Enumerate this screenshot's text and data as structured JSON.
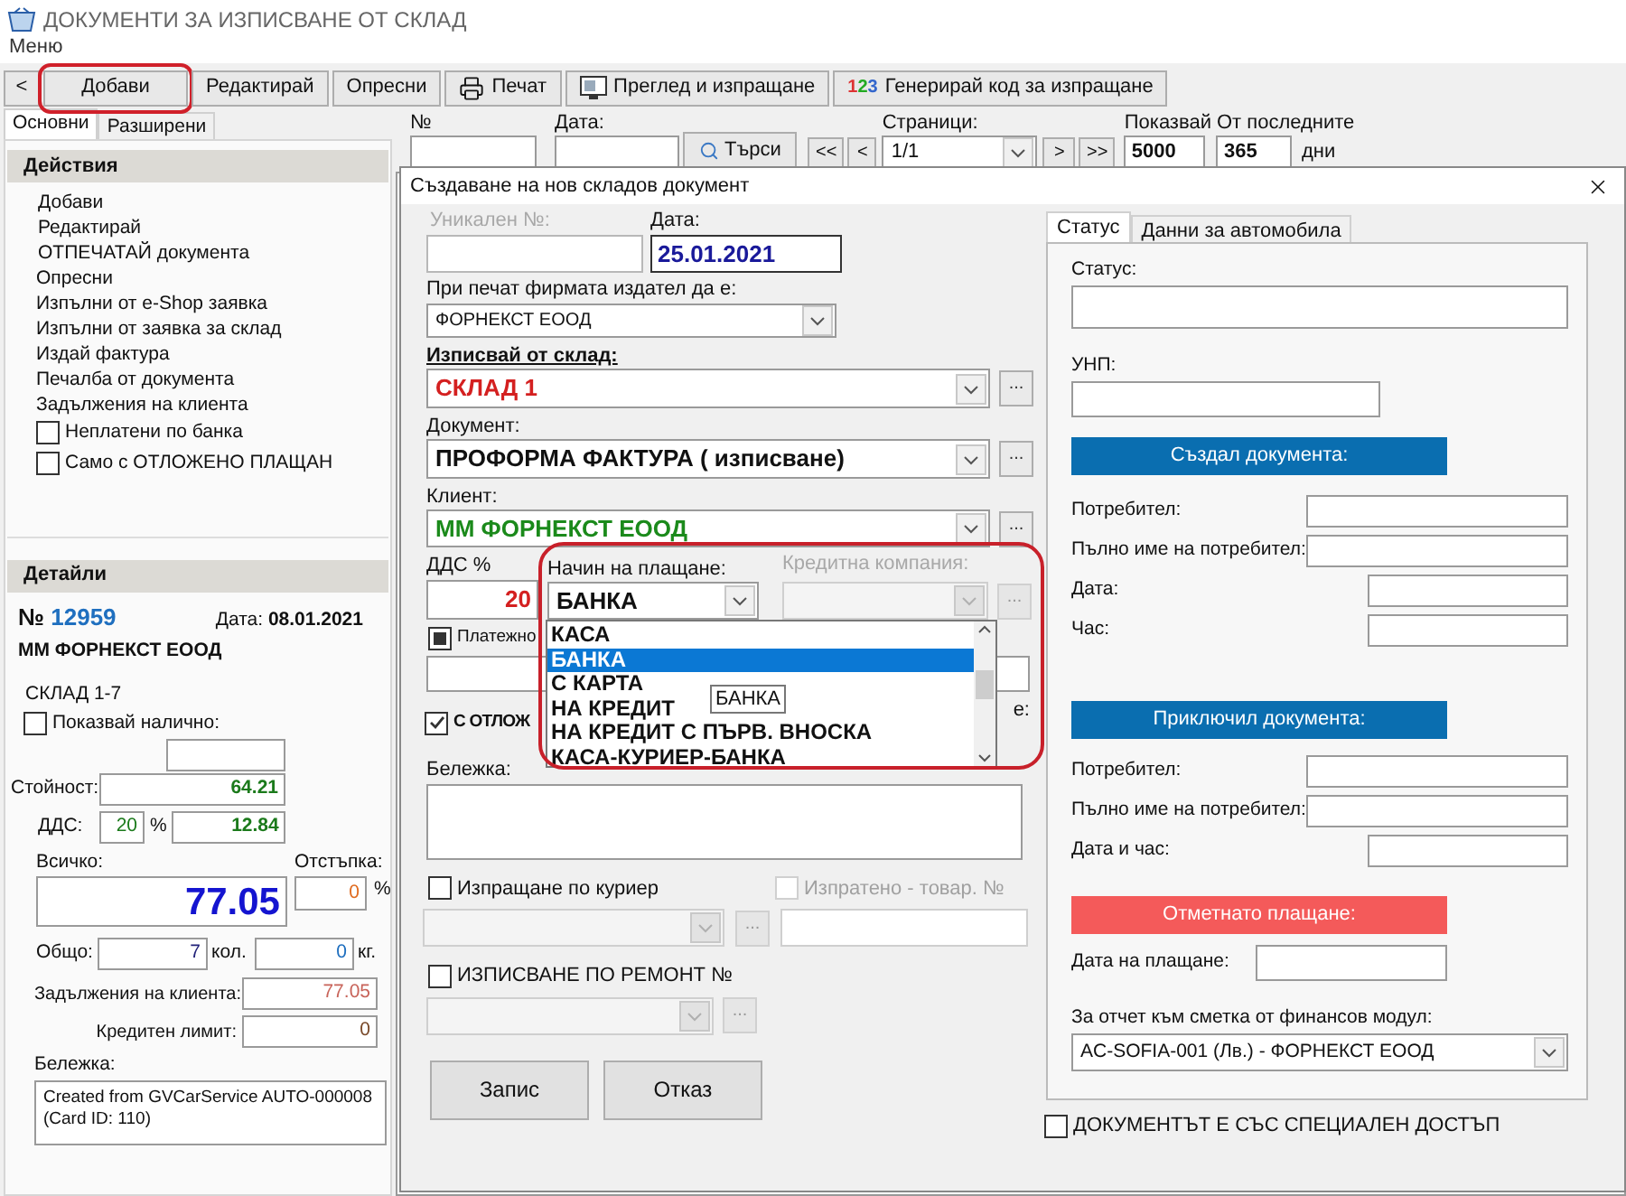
{
  "window": {
    "title": "ДОКУМЕНТИ ЗА ИЗПИСВАНЕ ОТ СКЛАД"
  },
  "menu": [
    "Меню"
  ],
  "toolbar": [
    {
      "label": "<",
      "kind": "plain",
      "highlighted": false
    },
    {
      "label": "Добави",
      "kind": "plain",
      "highlighted": true
    },
    {
      "label": "Редактирай",
      "kind": "plain",
      "highlighted": false
    },
    {
      "label": "Опресни",
      "kind": "plain",
      "highlighted": false
    },
    {
      "label": "Печат",
      "kind": "printer",
      "highlighted": false
    },
    {
      "label": "Преглед и изпращане",
      "kind": "preview",
      "highlighted": false
    },
    {
      "label": "Генерирай код за изпращане",
      "kind": "code",
      "prefix": "123",
      "highlighted": false
    }
  ],
  "side_tabs": [
    {
      "label": "Основни",
      "selected": true
    },
    {
      "label": "Разширени",
      "selected": false
    }
  ],
  "actions": {
    "title": "Действия",
    "items": [
      {
        "kind": "link",
        "label": "Добави"
      },
      {
        "kind": "link",
        "label": "Редактирай"
      },
      {
        "kind": "link",
        "label": "ОТПЕЧАТАЙ документа"
      },
      {
        "kind": "link",
        "label": "Опресни"
      },
      {
        "kind": "link",
        "label": "Изпълни от e-Shop заявка"
      },
      {
        "kind": "link",
        "label": "Изпълни от заявка за склад"
      },
      {
        "kind": "link",
        "label": "Издай фактура"
      },
      {
        "kind": "link",
        "label": "Печалба от документа"
      },
      {
        "kind": "link",
        "label": "Задължения на клиента"
      },
      {
        "kind": "checkbox",
        "label": "Неплатени по банка",
        "checked": false
      },
      {
        "kind": "checkbox",
        "label": "Само с ОТЛОЖЕНО ПЛАЩАН",
        "checked": false
      }
    ]
  },
  "details": {
    "title": "Детайли",
    "number_label": "№",
    "number": "12959",
    "date_label": "Дата:",
    "date": "08.01.2021",
    "client": "ММ ФОРНЕКСТ ЕООД",
    "warehouse": "СКЛАД 1-7",
    "show_available": {
      "label": "Показвай налично:",
      "checked": false
    },
    "value_label": "Стойност:",
    "value": "64.21",
    "vat_label": "ДДС:",
    "vat_rate": "20",
    "vat_pct": "%",
    "vat": "12.84",
    "total_label": "Всичко:",
    "total": "77.05",
    "discount_label": "Отстъпка:",
    "discount": "0",
    "discount_pct": "%",
    "sum_label": "Общо:",
    "qty": "7",
    "qty_unit": "кол.",
    "weight": "0",
    "weight_unit": "кг.",
    "debts_label": "Задължения на клиента:",
    "debts": "77.05",
    "credit_label": "Кредитен лимит:",
    "credit": "0",
    "note_label": "Бележка:",
    "note_lines": [
      "Created from GVCarService AUTO-000008",
      "(Card ID: 110)"
    ]
  },
  "search": {
    "number_label": "№",
    "date_label": "Дата:",
    "search_button": "Търси",
    "pages_label": "Страници:",
    "first": "<<",
    "prev": "<",
    "page": "1/1",
    "next": ">",
    "last": ">>",
    "show_label": "Показвай",
    "show": "5000",
    "recent_label": "От последните",
    "recent": "365",
    "days": "дни"
  },
  "dialog": {
    "title": "Създаване на нов складов документ",
    "unique_label": "Уникален №:",
    "date_label": "Дата:",
    "date": "25.01.2021",
    "issuer_label": "При печат фирмата издател да е:",
    "issuer": "ФОРНЕКСТ ЕООД",
    "warehouse_label": "Изписвай от склад:",
    "warehouse": "СКЛАД 1",
    "warehouse_more": "...",
    "document_label": "Документ:",
    "document": "ПРОФОРМА ФАКТУРА ( изписване)",
    "document_more": "...",
    "client_label": "Клиент:",
    "client": "ММ ФОРНЕКСТ ЕООД",
    "client_more": "...",
    "vat_label": "ДДС %",
    "vat": "20",
    "payment": {
      "label": "Начин на плащане:",
      "value": "БАНКА",
      "highlighted": true,
      "tooltip": "БАНКА",
      "options": [
        {
          "label": "КАСА",
          "selected": false
        },
        {
          "label": "БАНКА",
          "selected": true
        },
        {
          "label": "С КАРТА",
          "selected": false
        },
        {
          "label": "НА КРЕДИТ",
          "selected": false
        },
        {
          "label": "НА КРЕДИТ С ПЪРВ. ВНОСКА",
          "selected": false
        },
        {
          "label": "КАСА-КУРИЕР-БАНКА",
          "selected": false
        }
      ]
    },
    "credit_company_label": "Кредитна компания:",
    "credit_company_more": "...",
    "order": {
      "label": "Платежно",
      "checked": true
    },
    "side_label": "е:",
    "deferred": {
      "label": "С ОТЛОЖ",
      "checked": true
    },
    "note_label": "Бележка:",
    "courier": {
      "label": "Изпращане по куриер",
      "checked": false,
      "more": "..."
    },
    "sent": {
      "label": "Изпратено - товар. №",
      "checked": false
    },
    "repair": {
      "label": "ИЗПИСВАНЕ ПО РЕМОНТ №",
      "checked": false,
      "more": "..."
    },
    "buttons": [
      "Запис",
      "Отказ"
    ],
    "tabs": [
      {
        "label": "Статус",
        "selected": true
      },
      {
        "label": "Данни за автомобила",
        "selected": false
      }
    ],
    "status_label": "Статус:",
    "unp_label": "УНП:",
    "created_header": "Създал документа:",
    "created_fields": [
      {
        "label": "Потребител:",
        "kind": "wide"
      },
      {
        "label": "Пълно име на потребител:",
        "kind": "wide"
      },
      {
        "label": "Дата:",
        "kind": "short"
      },
      {
        "label": "Час:",
        "kind": "short"
      }
    ],
    "closed_header": "Приключил документа:",
    "closed_fields": [
      {
        "label": "Потребител:",
        "kind": "wide"
      },
      {
        "label": "Пълно име на потребител:",
        "kind": "wide"
      },
      {
        "label": "Дата и час:",
        "kind": "short"
      }
    ],
    "paid_header": "Отметнато плащане:",
    "pay_date_label": "Дата на плащане:",
    "account_label": "За отчет към сметка от финансов модул:",
    "account": "AC-SOFIA-001 (Лв.)  - ФОРНЕКСТ ЕООД",
    "special": {
      "label": "ДОКУМЕНТЪТ Е СЪС СПЕЦИАЛЕН ДОСТЪП",
      "checked": false
    }
  }
}
